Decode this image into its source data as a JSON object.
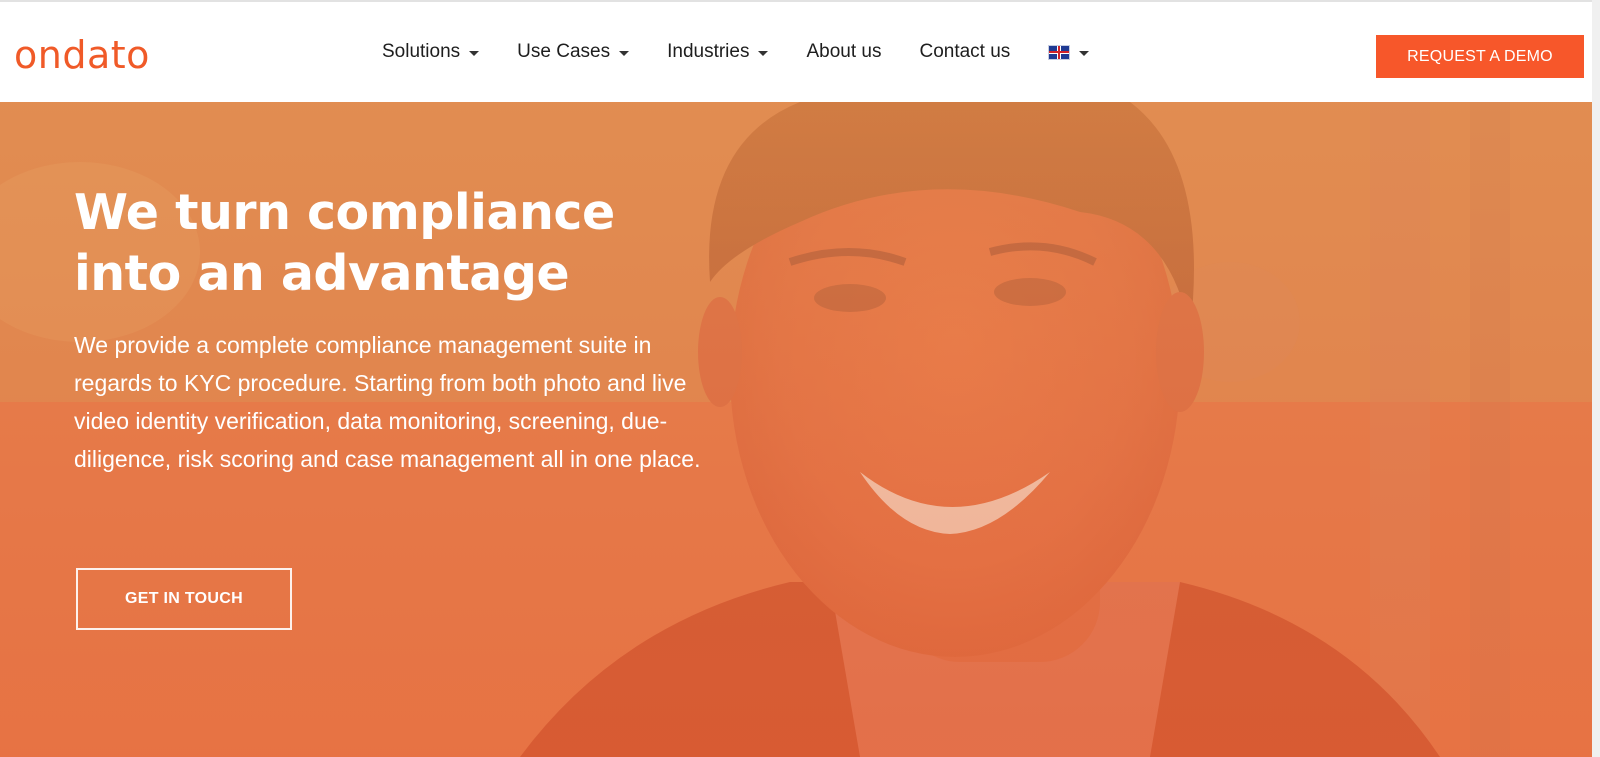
{
  "brand": {
    "logo_text": "ondato",
    "accent_color": "#f7572a"
  },
  "nav": {
    "items": [
      {
        "label": "Solutions",
        "has_dropdown": true
      },
      {
        "label": "Use Cases",
        "has_dropdown": true
      },
      {
        "label": "Industries",
        "has_dropdown": true
      },
      {
        "label": "About us",
        "has_dropdown": false
      },
      {
        "label": "Contact us",
        "has_dropdown": false
      }
    ],
    "language": {
      "icon": "uk-flag-icon",
      "has_dropdown": true
    },
    "cta_label": "REQUEST A DEMO"
  },
  "hero": {
    "title_line1": "We turn compliance",
    "title_line2": "into an advantage",
    "description": "We provide a complete compliance management suite in regards to KYC procedure. Starting from both photo and live video identity verification, data monitoring, screening, due-diligence, risk scoring and case management all in one place.",
    "button_label": "GET IN TOUCH",
    "overlay_color": "#e8703f"
  }
}
